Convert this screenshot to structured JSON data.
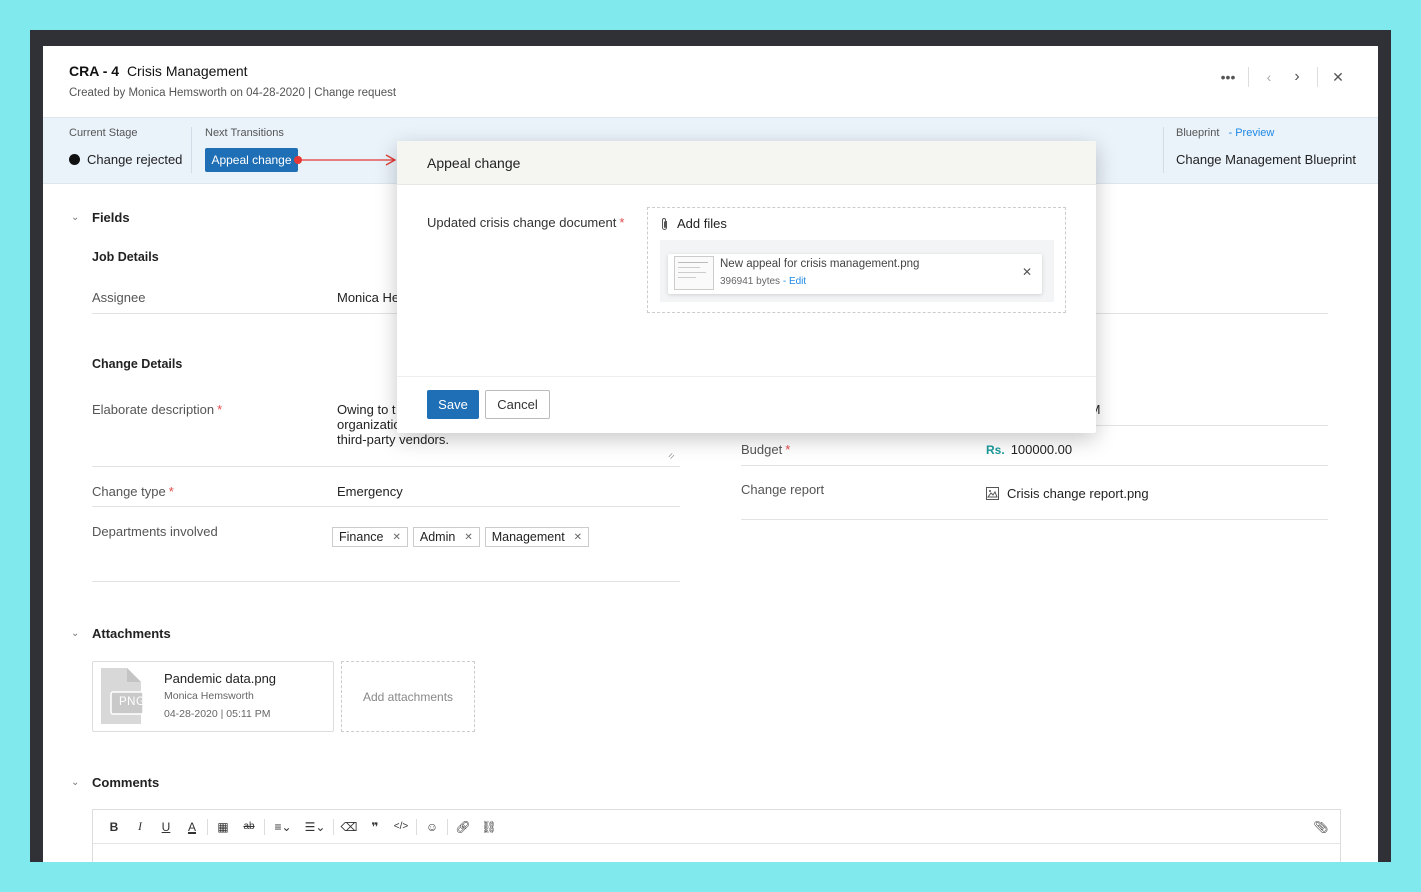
{
  "header": {
    "id": "CRA - 4",
    "title": "Crisis Management",
    "created_by_label": "Created by",
    "created_by": "Monica Hemsworth",
    "created_on": "on 04-28-2020",
    "type": "| Change request"
  },
  "stage": {
    "current_label": "Current Stage",
    "current_value": "Change rejected",
    "next_label": "Next Transitions",
    "next_button": "Appeal change",
    "blueprint_label": "Blueprint",
    "preview_link": "- Preview",
    "blueprint_value": "Change Management Blueprint"
  },
  "fields": {
    "section_title": "Fields",
    "job_details_title": "Job Details",
    "assignee_label": "Assignee",
    "assignee_value": "Monica He",
    "change_details_title": "Change Details",
    "description_label": "Elaborate description",
    "description_lines": [
      "Owing to t",
      "organizatio",
      "third-party vendors."
    ],
    "change_type_label": "Change type",
    "change_type_value": "Emergency",
    "departments_label": "Departments involved",
    "departments": [
      "Finance",
      "Admin",
      "Management"
    ],
    "right_time_partial": "PM",
    "budget_label": "Budget",
    "budget_currency": "Rs.",
    "budget_value": "100000.00",
    "change_report_label": "Change report",
    "change_report_value": "Crisis change report.png"
  },
  "attachments": {
    "section_title": "Attachments",
    "file_name": "Pandemic data.png",
    "file_type": "PNG",
    "uploader": "Monica Hemsworth",
    "date": "04-28-2020",
    "time": "05:11 PM",
    "add_label": "Add attachments"
  },
  "comments": {
    "section_title": "Comments",
    "toolbar": [
      "bold-icon",
      "italic-icon",
      "underline-icon",
      "font-color-icon",
      "table-icon",
      "strikethrough-icon",
      "align-icon",
      "list-icon",
      "eraser-icon",
      "quote-icon",
      "code-icon",
      "emoji-icon",
      "link-icon",
      "unlink-icon",
      "attach-icon"
    ]
  },
  "modal": {
    "title": "Appeal change",
    "field_label": "Updated crisis change document",
    "add_files": "Add files",
    "file_name": "New appeal for crisis management.png",
    "file_size": "396941 bytes",
    "edit_link": "- Edit",
    "save": "Save",
    "cancel": "Cancel"
  },
  "colors": {
    "accent": "#1e6fb5",
    "background": "#7fe9ee",
    "required": "#e04b4b",
    "currency": "#1a9a9a",
    "arrow": "#e53935"
  }
}
